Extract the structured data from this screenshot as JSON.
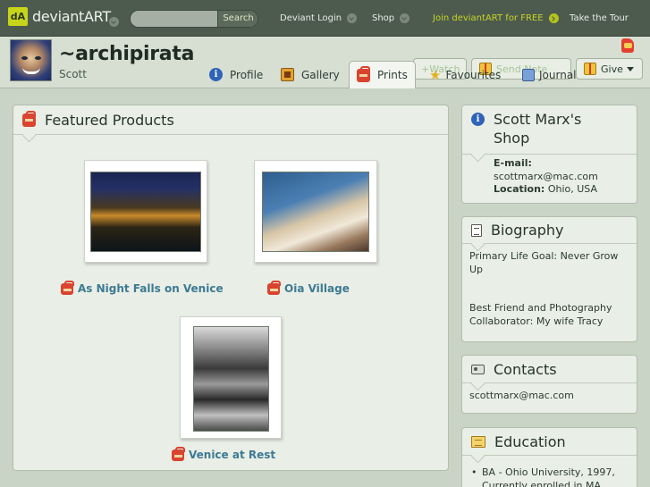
{
  "topbar": {
    "logo_text": "deviantART",
    "search_placeholder": "",
    "search_button": "Search",
    "deviant_login": "Deviant Login",
    "shop": "Shop",
    "join": "Join deviantART for FREE",
    "take_tour": "Take the Tour"
  },
  "profile": {
    "username": "~archipirata",
    "real_name": "Scott"
  },
  "tabs": [
    {
      "label": "Profile"
    },
    {
      "label": "Gallery"
    },
    {
      "label": "Prints"
    }
  ],
  "actions": {
    "watch": "+Watch",
    "favourites": "Favourites",
    "send_note": "Send Note",
    "journal": "Journal",
    "give": "Give"
  },
  "featured": {
    "title": "Featured Products",
    "products": [
      {
        "title": "As Night Falls on Venice"
      },
      {
        "title": "Oia Village"
      },
      {
        "title": "Venice at Rest"
      }
    ]
  },
  "shop_panel": {
    "title": "Scott Marx's Shop",
    "email_label": "E-mail:",
    "email": "scottmarx@mac.com",
    "location_label": "Location:",
    "location": "Ohio, USA"
  },
  "biography": {
    "title": "Biography",
    "line1": "Primary Life Goal: Never Grow Up",
    "line2": "Best Friend and Photography Collaborator: My wife Tracy"
  },
  "contacts": {
    "title": "Contacts",
    "email": "scottmarx@mac.com"
  },
  "education": {
    "title": "Education",
    "item1": "BA - Ohio University, 1997,",
    "item1_cont": "Currently enrolled in MA"
  }
}
